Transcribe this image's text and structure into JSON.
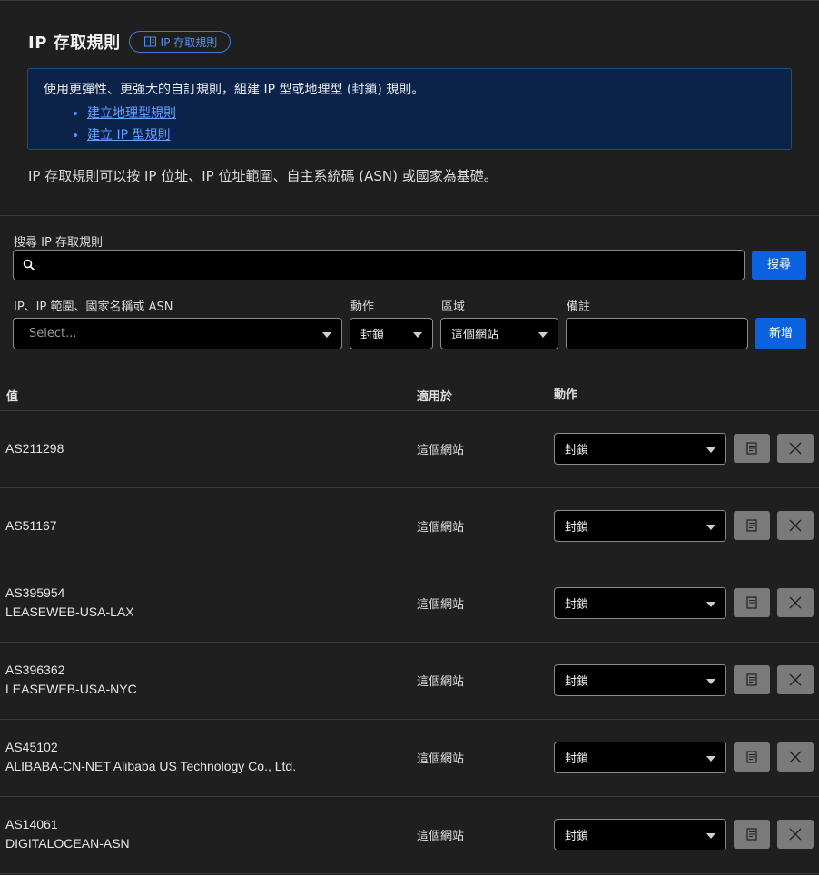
{
  "page": {
    "title": "IP 存取規則",
    "doc_link": "IP 存取規則",
    "info": {
      "text": "使用更彈性、更強大的自訂規則，組建 IP 型或地理型 (封鎖) 規則。",
      "links": [
        "建立地理型規則",
        "建立 IP 型規則"
      ]
    },
    "description": "IP 存取規則可以按 IP 位址、IP 位址範圍、自主系統碼 (ASN) 或國家為基礎。"
  },
  "search": {
    "label": "搜尋 IP 存取規則",
    "placeholder": "",
    "button": "搜尋"
  },
  "form": {
    "value_label": "IP、IP 範圍、國家名稱或 ASN",
    "value_placeholder": "Select...",
    "action_label": "動作",
    "action_value": "封鎖",
    "zone_label": "區域",
    "zone_value": "這個網站",
    "note_label": "備註",
    "add_button": "新增"
  },
  "table": {
    "headers": {
      "value": "值",
      "applies": "適用於",
      "action": "動作"
    },
    "rows": [
      {
        "value": "AS211298",
        "name": "",
        "scope": "這個網站",
        "action": "封鎖"
      },
      {
        "value": "AS51167",
        "name": "",
        "scope": "這個網站",
        "action": "封鎖"
      },
      {
        "value": "AS395954",
        "name": "LEASEWEB-USA-LAX",
        "scope": "這個網站",
        "action": "封鎖"
      },
      {
        "value": "AS396362",
        "name": "LEASEWEB-USA-NYC",
        "scope": "這個網站",
        "action": "封鎖"
      },
      {
        "value": "AS45102",
        "name": "ALIBABA-CN-NET Alibaba US Technology Co., Ltd.",
        "scope": "這個網站",
        "action": "封鎖"
      },
      {
        "value": "AS14061",
        "name": "DIGITALOCEAN-ASN",
        "scope": "這個網站",
        "action": "封鎖"
      }
    ]
  },
  "icons": {
    "doc": "book-icon",
    "search": "search-icon",
    "note": "note-icon",
    "delete": "close-icon",
    "dropdown": "caret-down-icon"
  },
  "colors": {
    "background": "#1f1f1f",
    "accent": "#0a62e0",
    "info_bg": "#0b2249",
    "link": "#62a1ff"
  }
}
